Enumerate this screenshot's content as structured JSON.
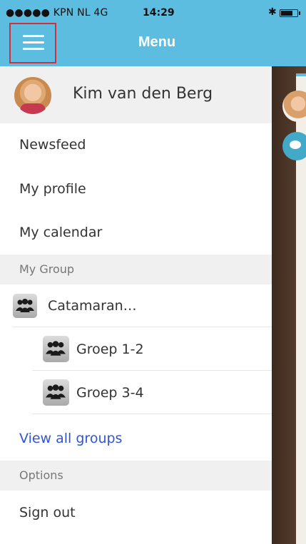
{
  "status_bar": {
    "carrier": "●●●●● KPN NL  4G",
    "time": "14:29",
    "bluetooth": "✱"
  },
  "header": {
    "title": "Menu",
    "menu_icon": "hamburger-icon",
    "color": "#5dbde0"
  },
  "profile": {
    "name": "Kim van den Berg"
  },
  "menu_items": [
    {
      "label": "Newsfeed"
    },
    {
      "label": "My profile"
    },
    {
      "label": "My calendar"
    }
  ],
  "sections": {
    "my_group": "My Group",
    "options": "Options"
  },
  "groups": [
    {
      "label": "Catamaran…"
    },
    {
      "label": "Groep 1-2"
    },
    {
      "label": "Groep 3-4"
    }
  ],
  "links": {
    "view_all_groups": "View all groups",
    "sign_out": "Sign out"
  },
  "colors": {
    "link": "#2f55d4",
    "highlight_border": "#d0303b"
  }
}
